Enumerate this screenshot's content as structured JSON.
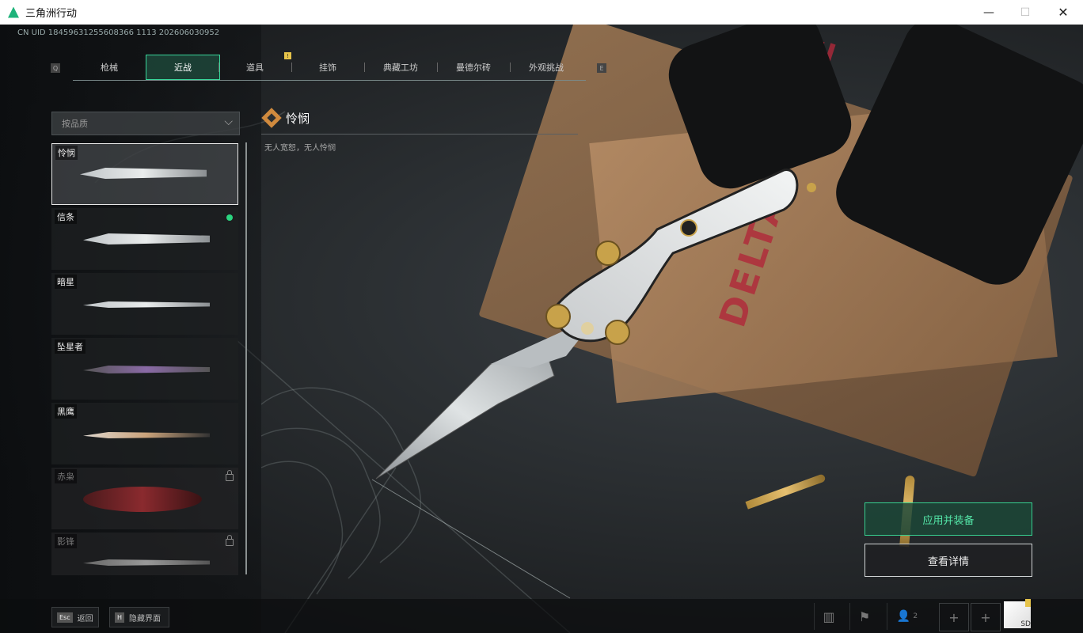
{
  "window": {
    "title": "三角洲行动",
    "minimize": "—",
    "maximize": "☐",
    "close": "✕"
  },
  "uid": "CN UID 18459631255608366 1113 202606030952",
  "tabs": {
    "left_key": "Q",
    "right_key": "E",
    "items": [
      {
        "label": "枪械"
      },
      {
        "label": "近战"
      },
      {
        "label": "道具"
      },
      {
        "label": "挂饰"
      },
      {
        "label": "典藏工坊"
      },
      {
        "label": "曼德尔砖"
      },
      {
        "label": "外观挑战"
      }
    ],
    "active_index": 1,
    "badge": "!"
  },
  "filter": {
    "label": "按品质",
    "chevron": "⌵"
  },
  "melee_list": [
    {
      "name": "怜悯",
      "selected": true,
      "locked": false
    },
    {
      "name": "信条",
      "selected": false,
      "locked": false,
      "new": true
    },
    {
      "name": "暗星",
      "selected": false,
      "locked": false
    },
    {
      "name": "坠星者",
      "selected": false,
      "locked": false
    },
    {
      "name": "黑鹰",
      "selected": false,
      "locked": false
    },
    {
      "name": "赤枭",
      "selected": false,
      "locked": true
    },
    {
      "name": "影锋",
      "selected": false,
      "locked": true
    }
  ],
  "detail": {
    "title": "怜悯",
    "description": "无人宽恕，无人怜悯"
  },
  "scene_text": {
    "folder": "DELTA FORCE"
  },
  "actions": {
    "equip": "应用并装备",
    "view_details": "查看详情"
  },
  "bottom": {
    "back_key": "Esc",
    "back_label": "返回",
    "hide_key": "H",
    "hide_label": "隐藏界面",
    "stats_icon": "▥",
    "flag_icon": "⚑",
    "friends_icon": "👤",
    "friends_count": "2",
    "plus1": "+",
    "plus2": "+",
    "avatar_text": "SD"
  },
  "colors": {
    "accent": "#36cf8f",
    "selected_border": "#e8e8e8",
    "detail_icon": "#d08a3e"
  }
}
